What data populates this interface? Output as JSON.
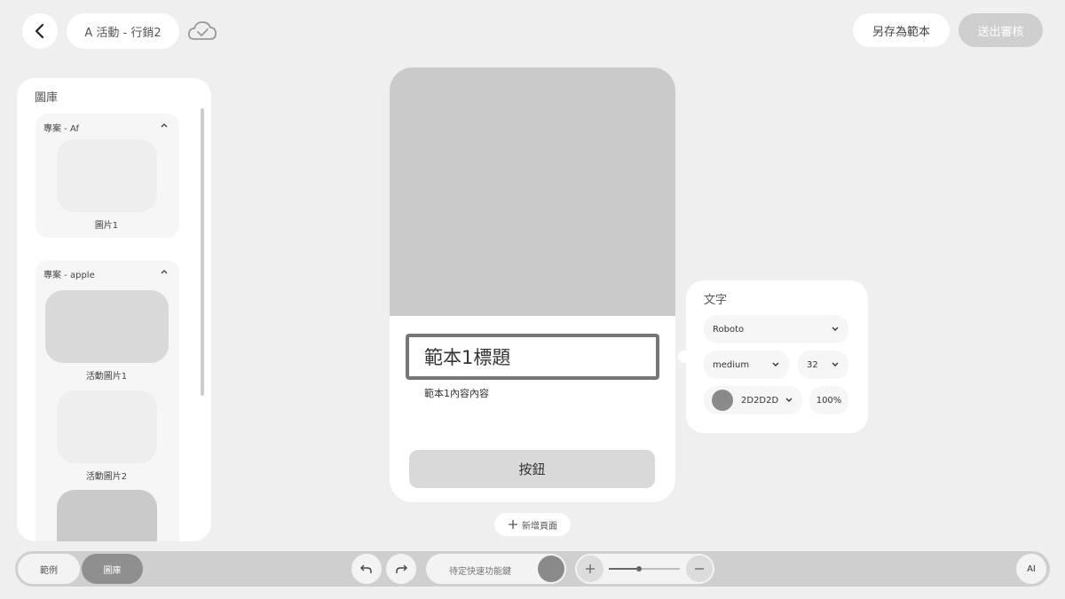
{
  "header": {
    "project_title": "A 活動 - 行銷2",
    "save_template_label": "另存為範本",
    "submit_review_label": "送出審核"
  },
  "gallery": {
    "title": "圖庫",
    "projects": [
      {
        "name": "專案 - Af",
        "images": [
          {
            "label": "圖片1",
            "color": "#eeeeee"
          }
        ]
      },
      {
        "name": "專案 - apple",
        "images": [
          {
            "label": "活動圖片1",
            "color": "#d9d9d9"
          },
          {
            "label": "活動圖片2",
            "color": "#eeeeee"
          },
          {
            "label": "",
            "color": "#cacaca"
          }
        ]
      }
    ]
  },
  "canvas": {
    "title_text": "範本1標題",
    "body_text": "範本1內容內容",
    "button_label": "按鈕",
    "add_page_label": "新增頁面"
  },
  "text_panel": {
    "title": "文字",
    "font_family": "Roboto",
    "font_weight": "medium",
    "font_size": "32",
    "color_hex": "2D2D2D",
    "color_swatch": "#8a8a8a",
    "opacity": "100%"
  },
  "bottom_bar": {
    "tab_examples": "範例",
    "tab_gallery": "圖庫",
    "active_tab": "圖庫",
    "quick_key_label": "待定快速功能鍵",
    "zoom_level": 0.43,
    "ai_label": "AI"
  }
}
